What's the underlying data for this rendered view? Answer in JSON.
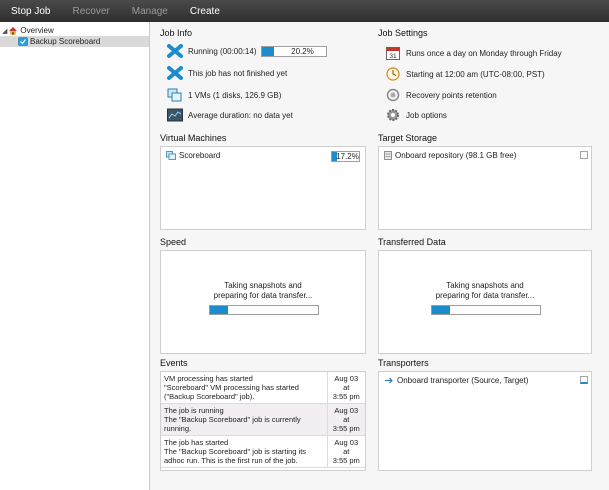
{
  "toolbar": {
    "stop_job": "Stop Job",
    "recover": "Recover",
    "manage": "Manage",
    "create": "Create"
  },
  "sidebar": {
    "overview": "Overview",
    "backup_item": "Backup Scoreboard"
  },
  "job_info": {
    "title": "Job Info",
    "running": "Running (00:00:14)",
    "progress_label": "20.2%",
    "progress": 0.202,
    "not_finished": "This job has not finished yet",
    "vms": "1 VMs (1 disks, 126.9 GB)",
    "avg_duration": "Average duration: no data yet"
  },
  "job_settings": {
    "title": "Job Settings",
    "schedule": "Runs once a day on Monday through Friday",
    "starting": "Starting at 12:00 am (UTC-08:00, PST)",
    "retention": "Recovery points retention",
    "options": "Job options"
  },
  "virtual_machines": {
    "title": "Virtual Machines",
    "vm_name": "Scoreboard",
    "vm_progress_label": "17.2%",
    "vm_progress": 0.172
  },
  "target_storage": {
    "title": "Target Storage",
    "repo": "Onboard repository (98.1 GB free)"
  },
  "speed": {
    "title": "Speed",
    "line1": "Taking snapshots and",
    "line2": "preparing for data transfer...",
    "progress": 0.17
  },
  "transferred": {
    "title": "Transferred Data",
    "line1": "Taking snapshots and",
    "line2": "preparing for data transfer...",
    "progress": 0.17
  },
  "events": {
    "title": "Events",
    "rows": [
      {
        "l1": "VM processing has started",
        "l2": "\"Scoreboard\" VM processing has started",
        "l3": "(\"Backup Scoreboard\" job).",
        "d1": "Aug 03 at",
        "d2": "3:55 pm"
      },
      {
        "l1": "The job is running",
        "l2": "The \"Backup Scoreboard\" job is currently",
        "l3": "running.",
        "d1": "Aug 03 at",
        "d2": "3:55 pm"
      },
      {
        "l1": "The job has started",
        "l2": "The \"Backup Scoreboard\" job is starting its",
        "l3": "adhoc run. This is the first run of the job.",
        "d1": "Aug 03 at",
        "d2": "3:55 pm"
      }
    ]
  },
  "transporters": {
    "title": "Transporters",
    "item": "Onboard transporter (Source, Target)"
  },
  "colors": {
    "accent": "#1b8ccc",
    "link": "#1d63b8",
    "toolbar": "#3a3a3a"
  }
}
